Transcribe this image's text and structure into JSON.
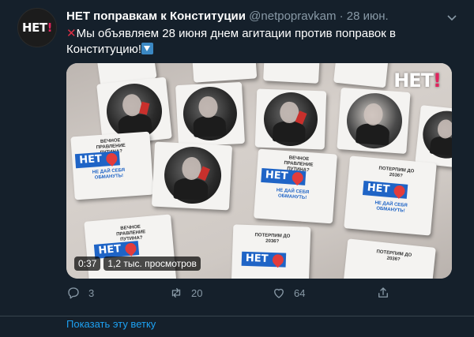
{
  "tweet": {
    "avatar_text": "НЕТ",
    "avatar_mark": "!",
    "author_name": "НЕТ поправкам к Конституции",
    "handle": "@netpopravkam",
    "separator": "·",
    "time": "28 июн.",
    "text_part1": "Мы объявляем 28 июня днем агитации против поправок в Конституцию!",
    "media": {
      "watermark_text": "НЕТ",
      "watermark_mark": "!",
      "duration": "0:37",
      "views": "1,2 тыс. просмотров",
      "badge_text": "НЕТ",
      "card_lines": {
        "vechnoe": "ВЕЧНОЕ ПРАВЛЕНИЕ ПУТИНА?",
        "ne_dai": "НЕ ДАЙ СЕБЯ ОБМАНУТЬ!",
        "poterpim": "ПОТЕРПИМ ДО 2036?"
      }
    },
    "actions": {
      "replies": "3",
      "retweets": "20",
      "likes": "64"
    }
  },
  "show_thread": "Показать эту ветку",
  "colors": {
    "background": "#15202b",
    "secondary_text": "#8899a6",
    "link": "#1da1f2",
    "accent_red": "#e0245e",
    "badge_blue": "#1f64c6"
  },
  "icons": [
    "chevron-down-icon",
    "cross-mark-icon",
    "down-arrow-icon",
    "reply-icon",
    "retweet-icon",
    "like-icon",
    "share-icon"
  ]
}
